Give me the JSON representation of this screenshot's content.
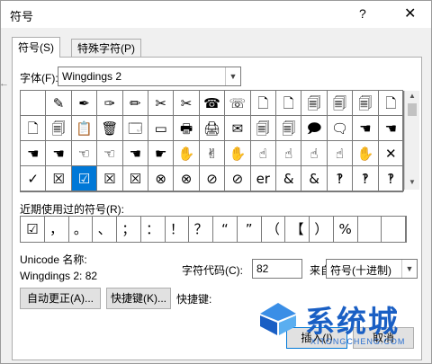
{
  "window": {
    "title": "符号",
    "help": "?",
    "close": "✕"
  },
  "edge_glyph": "←",
  "tabs": [
    {
      "label": "符号(S)"
    },
    {
      "label": "特殊字符(P)"
    }
  ],
  "font": {
    "label": "字体(F):",
    "value": "Wingdings 2"
  },
  "symbol_rows": [
    [
      "",
      "✎",
      "✒",
      "✑",
      "✏",
      "✂",
      "✂",
      "☎",
      "☏",
      "🗋",
      "🗋",
      "🗐",
      "🗐",
      "🗐",
      "🗋"
    ],
    [
      "🗋",
      "🗐",
      "📋",
      "🗑",
      "🗔",
      "▭",
      "🖶",
      "🖨",
      "✉",
      "🗐",
      "🗐",
      "🗩",
      "🗨",
      "☚",
      "☚"
    ],
    [
      "☚",
      "☚",
      "☜",
      "☜",
      "☚",
      "☛",
      "✋",
      "✌",
      "✋",
      "☝",
      "☝",
      "☝",
      "☝",
      "✋",
      "✕"
    ],
    [
      "✓",
      "☒",
      "☑",
      "☒",
      "☒",
      "⊗",
      "⊗",
      "⊘",
      "⊘",
      "er",
      "&",
      "&",
      "‽",
      "‽",
      "‽"
    ]
  ],
  "selected_symbol": {
    "row": 3,
    "col": 2
  },
  "recent": {
    "label": "近期使用过的符号(R):",
    "items": [
      "☑",
      "，",
      "。",
      "、",
      "；",
      "：",
      "！",
      "？",
      "“",
      "”",
      "（",
      "【",
      "）",
      "%",
      "",
      ""
    ]
  },
  "unicode_name": {
    "label": "Unicode 名称:",
    "value": "Wingdings 2: 82"
  },
  "char_code": {
    "label": "字符代码(C):",
    "value": "82"
  },
  "from": {
    "label": "来自(M):",
    "value": "符号(十进制)"
  },
  "buttons": {
    "autocorrect": "自动更正(A)...",
    "shortcut_key": "快捷键(K)...",
    "insert": "插入(I)",
    "cancel": "取消"
  },
  "shortcut_label": "快捷键:",
  "watermark": {
    "text": "系统城",
    "sub": "XITONGCHENG.COM",
    "accent": "#1a5fc4"
  }
}
